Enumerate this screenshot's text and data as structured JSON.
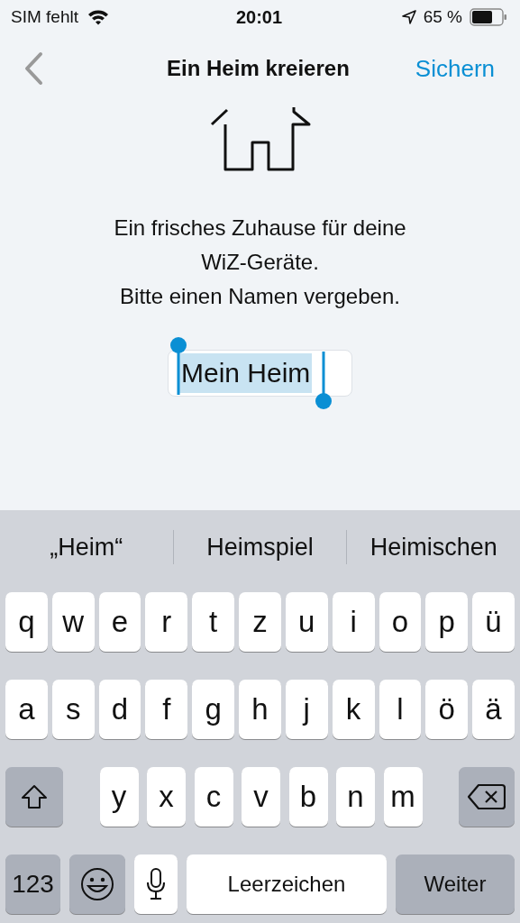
{
  "status_bar": {
    "carrier": "SIM fehlt",
    "time": "20:01",
    "battery": "65 %"
  },
  "nav": {
    "title": "Ein Heim kreieren",
    "action": "Sichern"
  },
  "message_lines": [
    "Ein frisches Zuhause für deine",
    "WiZ-Geräte.",
    "Bitte einen Namen vergeben."
  ],
  "name_field": {
    "value": "Mein Heim",
    "text_selected": true
  },
  "suggestions": [
    "„Heim“",
    "Heimspiel",
    "Heimischen"
  ],
  "keyboard_rows": [
    [
      {
        "kind": "letter",
        "label": "q"
      },
      {
        "kind": "letter",
        "label": "w"
      },
      {
        "kind": "letter",
        "label": "e"
      },
      {
        "kind": "letter",
        "label": "r"
      },
      {
        "kind": "letter",
        "label": "t"
      },
      {
        "kind": "letter",
        "label": "z"
      },
      {
        "kind": "letter",
        "label": "u"
      },
      {
        "kind": "letter",
        "label": "i"
      },
      {
        "kind": "letter",
        "label": "o"
      },
      {
        "kind": "letter",
        "label": "p"
      },
      {
        "kind": "letter",
        "label": "ü"
      }
    ],
    [
      {
        "kind": "letter",
        "label": "a"
      },
      {
        "kind": "letter",
        "label": "s"
      },
      {
        "kind": "letter",
        "label": "d"
      },
      {
        "kind": "letter",
        "label": "f"
      },
      {
        "kind": "letter",
        "label": "g"
      },
      {
        "kind": "letter",
        "label": "h"
      },
      {
        "kind": "letter",
        "label": "j"
      },
      {
        "kind": "letter",
        "label": "k"
      },
      {
        "kind": "letter",
        "label": "l"
      },
      {
        "kind": "letter",
        "label": "ö"
      },
      {
        "kind": "letter",
        "label": "ä"
      }
    ],
    [
      {
        "kind": "shift"
      },
      {
        "kind": "letter",
        "label": "y"
      },
      {
        "kind": "letter",
        "label": "x"
      },
      {
        "kind": "letter",
        "label": "c"
      },
      {
        "kind": "letter",
        "label": "v"
      },
      {
        "kind": "letter",
        "label": "b"
      },
      {
        "kind": "letter",
        "label": "n"
      },
      {
        "kind": "letter",
        "label": "m"
      },
      {
        "kind": "delete"
      }
    ],
    [
      {
        "kind": "numbers",
        "label": "123"
      },
      {
        "kind": "emoji"
      },
      {
        "kind": "mic"
      },
      {
        "kind": "space",
        "label": "Leerzeichen"
      },
      {
        "kind": "return",
        "label": "Weiter"
      }
    ]
  ]
}
